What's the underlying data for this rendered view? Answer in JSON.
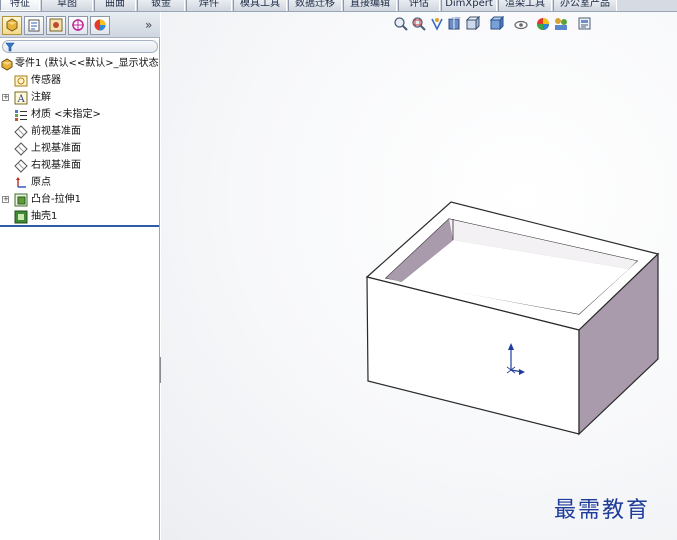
{
  "command_tabs": [
    "特征",
    "草图",
    "曲面",
    "钣金",
    "焊件",
    "模具工具",
    "数据迁移",
    "直接编辑",
    "评估",
    "DimXpert",
    "渲染工具",
    "办公室产品"
  ],
  "active_tab": "特征",
  "panel": {
    "tabs": [
      "feature-manager-icon",
      "property-manager-icon",
      "configuration-manager-icon",
      "dimxpert-manager-icon",
      "display-manager-icon"
    ],
    "more_glyph": "»",
    "filter_icon": "filter-icon"
  },
  "tree": {
    "root": "零件1 (默认<<默认>_显示状态",
    "items": [
      {
        "label": "传感器",
        "icon": "sensor-icon",
        "expandable": false
      },
      {
        "label": "注解",
        "icon": "annotation-icon",
        "expandable": true
      },
      {
        "label": "材质 <未指定>",
        "icon": "material-icon",
        "expandable": false
      },
      {
        "label": "前视基准面",
        "icon": "plane-icon",
        "expandable": false
      },
      {
        "label": "上视基准面",
        "icon": "plane-icon",
        "expandable": false
      },
      {
        "label": "右视基准面",
        "icon": "plane-icon",
        "expandable": false
      },
      {
        "label": "原点",
        "icon": "origin-icon",
        "expandable": false
      },
      {
        "label": "凸台-拉伸1",
        "icon": "boss-extrude-icon",
        "expandable": true
      },
      {
        "label": "抽壳1",
        "icon": "shell-icon",
        "expandable": false
      }
    ]
  },
  "view_toolbar": [
    "zoom-to-fit-icon",
    "zoom-to-area-icon",
    "previous-view-icon",
    "section-view-icon",
    "view-orientation-icon",
    "display-style-icon",
    "hide-show-icon",
    "appearance-icon",
    "scene-icon",
    "view-settings-icon"
  ],
  "watermark": "最需教育",
  "colors": {
    "inner_wall": "#a99aac",
    "model_face": "#ffffff",
    "edge": "#2a2a2a",
    "accent_blue": "#1f3c9b"
  }
}
